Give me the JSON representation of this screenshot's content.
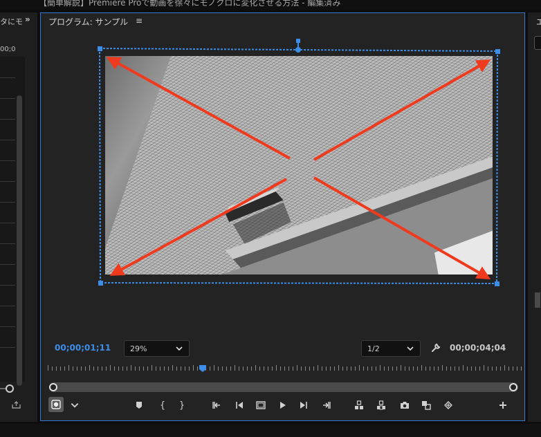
{
  "window": {
    "title": "【簡単解説】Premiere Proで動画を徐々にモノクロに変化させる方法 - 編集済み"
  },
  "left_panel": {
    "title": "タにモ",
    "timecode": "00;0",
    "chevron_icon": "double-chevron-right-icon"
  },
  "program_monitor": {
    "title": "プログラム: サンプル",
    "menu_icon": "hamburger-menu-icon",
    "current_timecode": "00;00;01;11",
    "duration_timecode": "00;00;04;04",
    "zoom": {
      "value": "29%"
    },
    "resolution": {
      "value": "1/2"
    }
  },
  "right_panel": {
    "title": "エ"
  },
  "controls": [
    {
      "name": "add-marker-button",
      "icon": "marker-icon"
    },
    {
      "name": "mark-in-button",
      "label": "{"
    },
    {
      "name": "mark-out-button",
      "label": "}"
    },
    {
      "name": "go-to-in-button",
      "icon": "go-to-in-icon"
    },
    {
      "name": "step-back-button",
      "icon": "step-back-icon"
    },
    {
      "name": "safe-margins-button",
      "icon": "safe-margins-icon"
    },
    {
      "name": "play-button",
      "icon": "play-icon"
    },
    {
      "name": "step-forward-button",
      "icon": "step-forward-icon"
    },
    {
      "name": "go-to-out-button",
      "icon": "go-to-out-icon"
    },
    {
      "name": "lift-button",
      "icon": "lift-icon"
    },
    {
      "name": "extract-button",
      "icon": "extract-icon"
    },
    {
      "name": "export-frame-button",
      "icon": "camera-icon"
    },
    {
      "name": "comparison-view-button",
      "icon": "comparison-view-icon"
    },
    {
      "name": "proxy-toggle-button",
      "icon": "proxy-icon"
    },
    {
      "name": "button-editor-button",
      "icon": "plus-icon"
    }
  ],
  "colors": {
    "accent_blue": "#3d8ee8",
    "panel_border": "#2e7bd6",
    "arrow_red": "#f03a1e",
    "panel_bg": "#232323"
  }
}
